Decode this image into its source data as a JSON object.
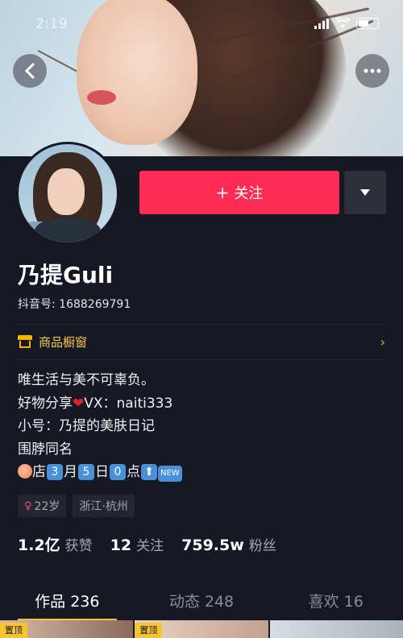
{
  "status_bar": {
    "time": "2:19"
  },
  "profile": {
    "follow_label": "关注",
    "name": "乃提Guli",
    "douyin_id": "抖音号: 1688269791",
    "shop_label": "商品橱窗",
    "bio": {
      "line1": "唯生活与美不可辜负。",
      "line2_prefix": "好物分享",
      "line2_suffix": "VX：naiti333",
      "line3": "小号：乃提的美肤日记",
      "line4": "围脖同名",
      "line5": {
        "store": "店",
        "month_num": "3",
        "month": "月",
        "day_num": "5",
        "day": "日",
        "hour_num": "0",
        "hour": "点",
        "new_badge": "NEW"
      }
    },
    "tags": {
      "age": "22岁",
      "location": "浙江·杭州"
    },
    "stats": [
      {
        "num": "1.2亿",
        "label": "获赞"
      },
      {
        "num": "12",
        "label": "关注"
      },
      {
        "num": "759.5w",
        "label": "粉丝"
      }
    ]
  },
  "tabs": [
    {
      "label": "作品 236"
    },
    {
      "label": "动态 248"
    },
    {
      "label": "喜欢 16"
    }
  ],
  "thumbnails": [
    {
      "pin": "置顶"
    },
    {
      "pin": "置顶"
    },
    {
      "pin": ""
    }
  ],
  "colors": {
    "accent": "#fe2c55",
    "highlight": "#f6c531",
    "background": "#161823"
  }
}
